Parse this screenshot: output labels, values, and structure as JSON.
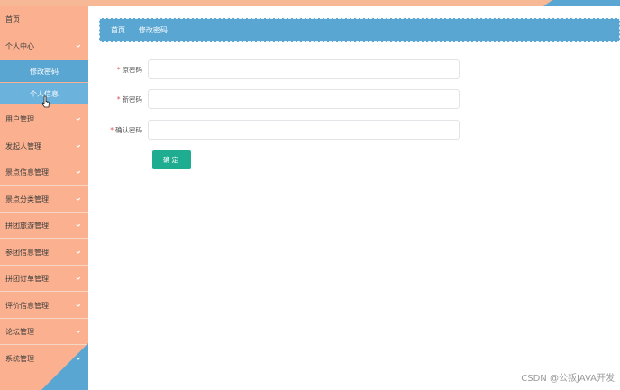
{
  "sidebar": {
    "home": "首页",
    "personal_center": "个人中心",
    "sub_change_password": "修改密码",
    "sub_personal_info": "个人信息",
    "items": [
      "用户管理",
      "发起人管理",
      "景点信息管理",
      "景点分类管理",
      "拼团旅游管理",
      "参团信息管理",
      "拼团订单管理",
      "评价信息管理",
      "论坛管理",
      "系统管理"
    ]
  },
  "breadcrumb": {
    "home": "首页",
    "separator": "|",
    "current": "修改密码"
  },
  "form": {
    "required_mark": "*",
    "old_password_label": "原密码",
    "new_password_label": "新密码",
    "confirm_password_label": "确认密码",
    "old_password_value": "",
    "new_password_value": "",
    "confirm_password_value": "",
    "confirm_button": "确定"
  },
  "watermark": "CSDN @公叛JAVA开发",
  "colors": {
    "sidebar": "#fbb18f",
    "accent_blue": "#5aa6d3",
    "confirm_button": "#1fad91",
    "required": "#e05050"
  },
  "icons": [
    "chevron-down-icon",
    "pointer-cursor-icon"
  ]
}
